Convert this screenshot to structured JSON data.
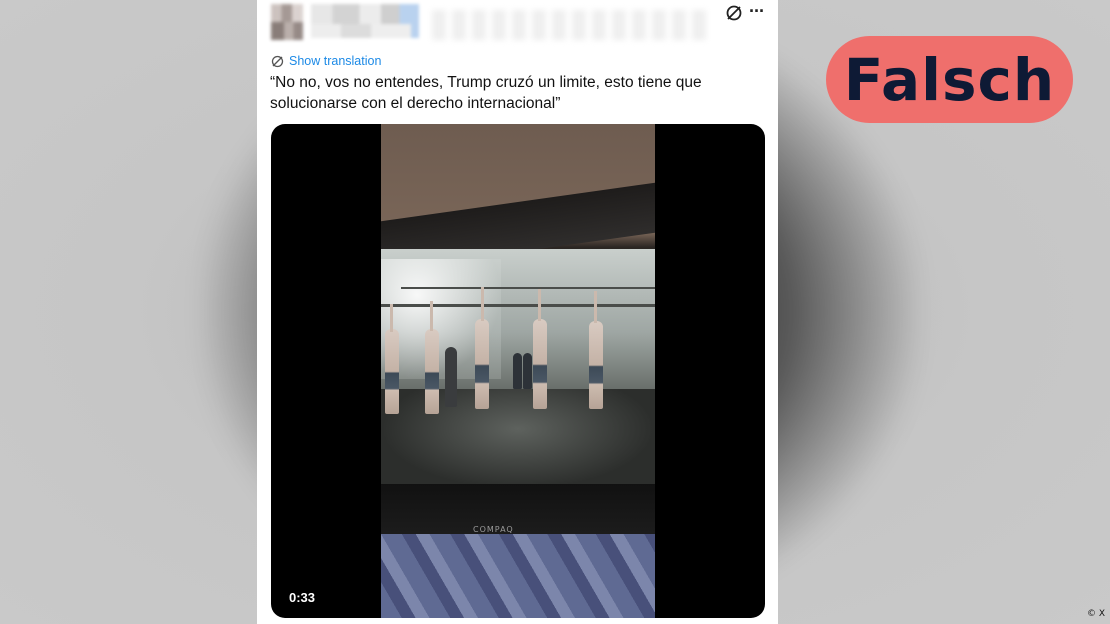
{
  "post": {
    "translate_label": "Show translation",
    "text": "“No no, vos no entendes, Trump cruzó un limite, esto tiene que solucionarse con el derecho internacional”",
    "video": {
      "duration": "0:33",
      "monitor_brand": "COMPAQ"
    },
    "icons": {
      "grok": "grok-icon",
      "more": "more-icon",
      "translate": "translate-icon"
    }
  },
  "verdict": {
    "label": "Falsch",
    "color": "#ef6f6c",
    "text_color": "#0e1a35"
  },
  "credit": "© X"
}
